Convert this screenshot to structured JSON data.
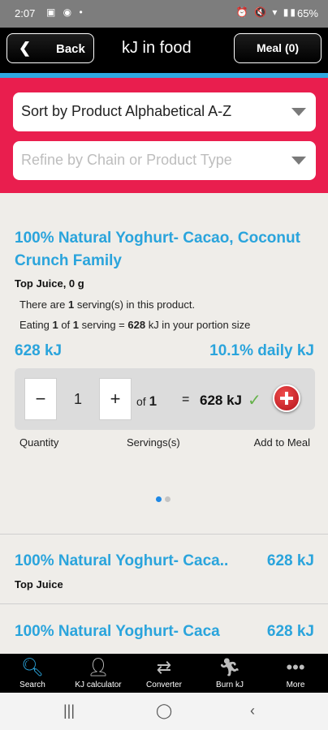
{
  "status": {
    "time": "2:07",
    "battery": "65%"
  },
  "header": {
    "back_label": "Back",
    "title": "kJ in food",
    "meal_label": "Meal (0)"
  },
  "filters": {
    "sort_value": "Sort by Product Alphabetical A-Z",
    "refine_placeholder": "Refine by Chain or Product Type"
  },
  "product": {
    "title": "100% Natural Yoghurt- Cacao, Coconut Crunch Family",
    "brand": "Top Juice, 0 g",
    "servings_line": "There are 1 serving(s) in this product.",
    "eating_line": "Eating 1 of 1 serving = 628 kJ in your portion size",
    "kj": "628 kJ",
    "daily": "10.1% daily kJ",
    "quantity": "1",
    "of_label": "of",
    "of_value": "1",
    "dash": "=",
    "total": "628 kJ",
    "captions": {
      "quantity": "Quantity",
      "servings": "Servings(s)",
      "add": "Add to Meal"
    }
  },
  "list": [
    {
      "title": "100% Natural Yoghurt- Caca..",
      "kj": "628 kJ",
      "brand": "Top Juice"
    },
    {
      "title": "100% Natural Yoghurt- Caca",
      "kj": "628 kJ"
    }
  ],
  "tabs": [
    {
      "label": "Search",
      "icon": "search-icon"
    },
    {
      "label": "KJ calculator",
      "icon": "person-icon"
    },
    {
      "label": "Converter",
      "icon": "swap-icon"
    },
    {
      "label": "Burn kJ",
      "icon": "runner-icon"
    },
    {
      "label": "More",
      "icon": "more-icon"
    }
  ],
  "colors": {
    "accent": "#2aa4dc",
    "filter_bg": "#e91e4e",
    "header": "#000000"
  }
}
